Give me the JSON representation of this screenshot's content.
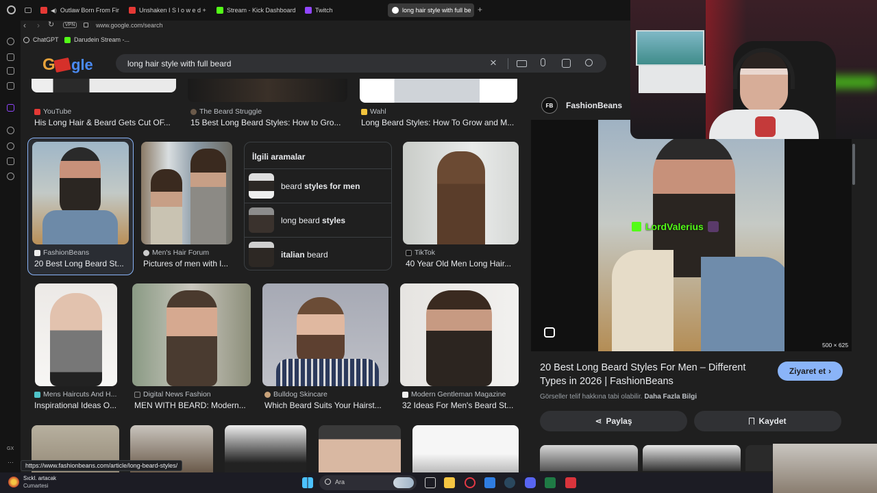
{
  "tabs": [
    {
      "label": "Outlaw Born From Fire",
      "color": "#e53935"
    },
    {
      "label": "Unshaken I S l o w e d + R",
      "color": "#e53935"
    },
    {
      "label": "Stream - Kick Dashboard",
      "color": "#53fc18"
    },
    {
      "label": "Twitch",
      "color": "#9146ff"
    },
    {
      "label": "long hair style with full be",
      "color": "#4285f4"
    }
  ],
  "address": {
    "vpn": "VPN",
    "url": "www.google.com/search"
  },
  "bookmarks": [
    {
      "label": "ChatGPT"
    },
    {
      "label": "Darudein Stream -..."
    }
  ],
  "search": {
    "query": "long hair style with full beard",
    "logo": "Google"
  },
  "top_row": [
    {
      "source": "YouTube",
      "title": "His Long Hair & Beard Gets Cut OF..."
    },
    {
      "source": "The Beard Struggle",
      "title": "15 Best Long Beard Styles: How to Gro..."
    },
    {
      "source": "Wahl",
      "title": "Long Beard Styles: How To Grow and M..."
    }
  ],
  "row2": [
    {
      "source": "FashionBeans",
      "title": "20 Best Long Beard St..."
    },
    {
      "source": "Men's Hair Forum",
      "title": "Pictures of men with l..."
    },
    {
      "source": "TikTok",
      "title": "40 Year Old Men Long Hair..."
    }
  ],
  "related": {
    "heading": "İlgili aramalar",
    "items": [
      {
        "plain": "beard ",
        "bold": "styles for men",
        "bold_first": false
      },
      {
        "plain": "long beard ",
        "bold": "styles",
        "bold_first": false
      },
      {
        "plain": " beard",
        "bold": "italian",
        "bold_first": true
      }
    ]
  },
  "row3": [
    {
      "source": "Mens Haircuts And H...",
      "title": "Inspirational Ideas O..."
    },
    {
      "source": "Digital News Fashion",
      "title": "MEN WITH BEARD: Modern..."
    },
    {
      "source": "Bulldog Skincare",
      "title": "Which Beard Suits Your Hairst..."
    },
    {
      "source": "Modern Gentleman Magazine",
      "title": "32 Ideas For Men's Beard St..."
    }
  ],
  "panel": {
    "source_initials": "FB",
    "source": "FashionBeans",
    "overlay_name": "LordValerius",
    "dimensions": "500 × 625",
    "title": "20 Best Long Beard Styles For Men – Different Types in 2026 | FashionBeans",
    "visit": "Ziyaret et",
    "copyright": "Görseller telif hakkına tabi olabilir.",
    "more_info": "Daha Fazla Bilgi",
    "share": "Paylaş",
    "save": "Kaydet"
  },
  "status_url": "https://www.fashionbeans.com/article/long-beard-styles/",
  "sidebar_gx": "GX",
  "taskbar": {
    "weather_line1": "Sıckl. artacak",
    "weather_line2": "Cumartesi",
    "search_placeholder": "Ara"
  },
  "colors": {
    "accent_blue": "#8ab4f8",
    "kick_green": "#53fc18"
  }
}
